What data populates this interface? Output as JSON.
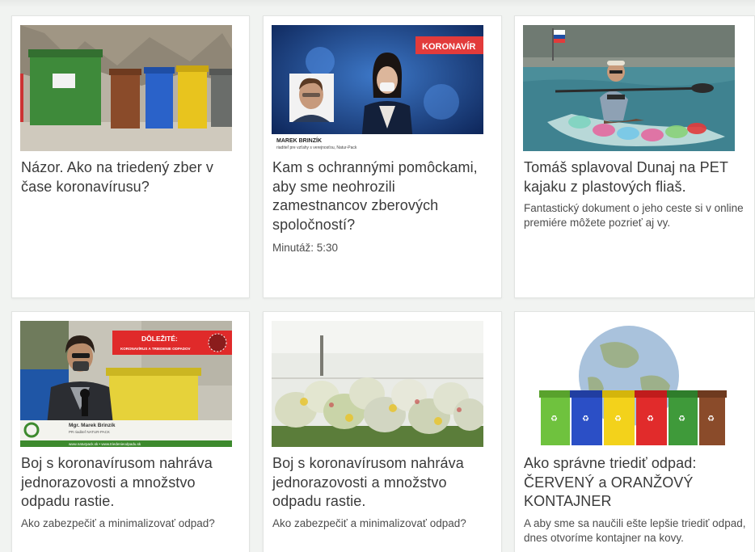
{
  "articles": [
    {
      "title": "Názor. Ako na triedený zber v čase koronavírusu?",
      "description": "",
      "image": "sorting-bins-photo"
    },
    {
      "title": "Kam s ochrannými pomôckami, aby sme neohrozili zamestnancov zberových spoločností?",
      "description": "Minutáž: 5:30",
      "image": "news-broadcast-photo",
      "image_texts": {
        "banner": "KORONAVÍR",
        "name": "MAREK BRINZÍK",
        "role": "riaditeľ pre vzťahy s verejnosťou, Natur-Pack"
      }
    },
    {
      "title": "Tomáš splavoval Dunaj na PET kajaku z plastových fliaš.",
      "description": "Fantastický dokument o jeho ceste si v online premiére môžete pozrieť aj vy.",
      "image": "pet-kayak-photo"
    },
    {
      "title": "Boj s koronavírusom nahráva jednorazovosti a množstvo odpadu rastie.",
      "description": "Ako zabezpečiť a minimalizovať odpad?",
      "image": "interview-photo",
      "image_texts": {
        "banner_title": "DÔLEŽITÉ:",
        "banner_sub": "KORONAVÍRUS A TRIEDENIE ODPADOV",
        "name": "Mgr. Marek Brinzík",
        "role": "PR riaditeľ NATUR-PACK",
        "links": "www.naturpack.sk  •  www.triedenieodpadu.sk"
      }
    },
    {
      "title": "Boj s koronavírusom nahráva jednorazovosti a množstvo odpadu rastie.",
      "description": "Ako zabezpečiť a minimalizovať odpad?",
      "image": "waste-bags-photo"
    },
    {
      "title": "Ako správne triediť odpad: ČERVENÝ a ORANŽOVÝ KONTAJNER",
      "description": "A aby sme sa naučili ešte lepšie triediť odpad, dnes otvoríme kontajner na kovy.",
      "image": "globe-bins-illustration"
    }
  ],
  "colors": {
    "page_bg": "#f1f3f1",
    "card_bg": "#ffffff",
    "title_text": "#3a3a3a",
    "red_accent": "#e23b3b",
    "green_accent": "#4aa332"
  }
}
